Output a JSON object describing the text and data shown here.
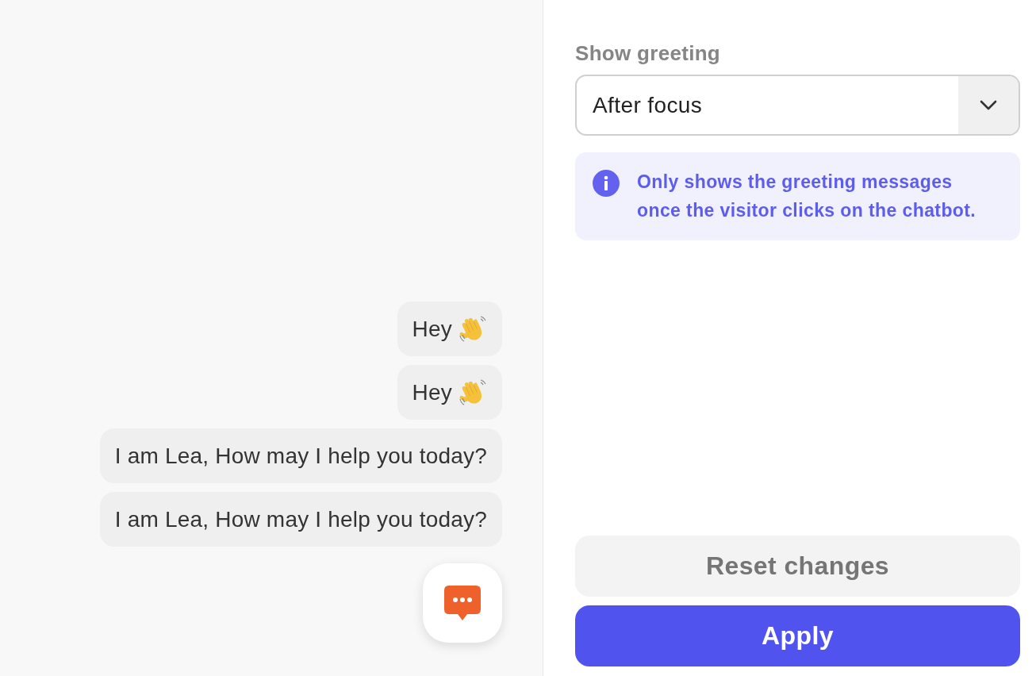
{
  "preview": {
    "messages": [
      {
        "text": "Hey",
        "kind": "wave"
      },
      {
        "text": "Hey",
        "kind": "wave"
      },
      {
        "text": "I am Lea, How may I help you today?",
        "kind": "plain"
      },
      {
        "text": "I am Lea, How may I help you today?",
        "kind": "plain"
      }
    ]
  },
  "settings": {
    "label": "Show greeting",
    "select": {
      "value": "After focus"
    },
    "info": "Only shows the greeting messages once the visitor clicks on the chatbot."
  },
  "buttons": [
    {
      "label": "Reset changes",
      "kind": "secondary"
    },
    {
      "label": "Apply",
      "kind": "primary"
    }
  ]
}
